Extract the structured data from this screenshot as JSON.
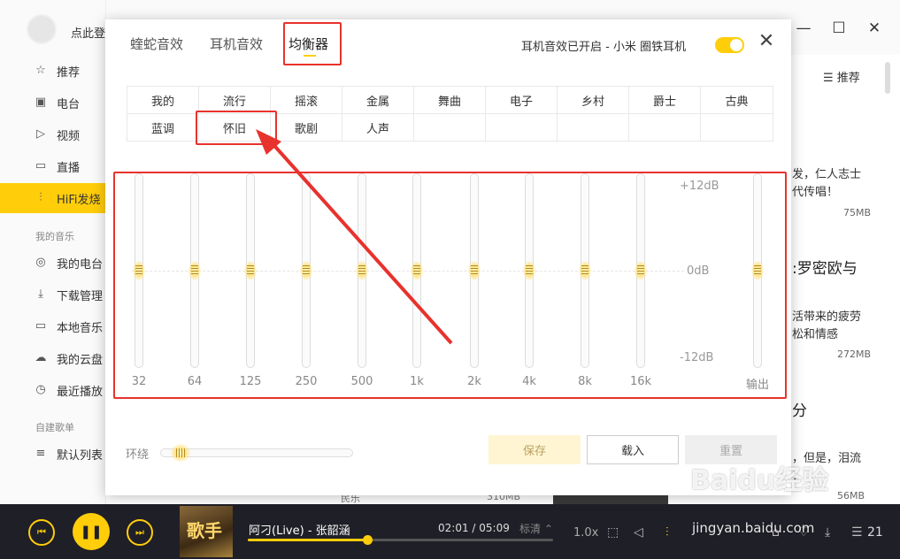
{
  "app": {
    "login_text": "点此登",
    "window_controls": [
      "—",
      "☐",
      "✕"
    ],
    "right_header": "推荐",
    "sidebar": {
      "items": [
        {
          "label": "推荐",
          "icon": "star-icon"
        },
        {
          "label": "电台",
          "icon": "radio-icon"
        },
        {
          "label": "视频",
          "icon": "video-icon"
        },
        {
          "label": "直播",
          "icon": "live-icon"
        },
        {
          "label": "HiFi发烧",
          "icon": "hifi-icon"
        }
      ],
      "section_my_music": "我的音乐",
      "my_items": [
        {
          "label": "我的电台",
          "icon": "podcast-icon"
        },
        {
          "label": "下载管理",
          "icon": "download-icon"
        },
        {
          "label": "本地音乐",
          "icon": "monitor-icon"
        },
        {
          "label": "我的云盘",
          "icon": "cloud-icon"
        },
        {
          "label": "最近播放",
          "icon": "clock-icon"
        }
      ],
      "section_playlists": "自建歌单",
      "playlist_items": [
        {
          "label": "默认列表",
          "icon": "list-icon"
        }
      ]
    },
    "background_fragments": {
      "frag1_line1": "发，仁人志士",
      "frag1_line2": "代传唱！",
      "size1": "75MB",
      "frag2_title": ":罗密欧与",
      "frag2_line1": "活带来的疲劳",
      "frag2_line2": "松和情感",
      "size2": "272MB",
      "frag3_title": "分",
      "frag3_line1": "，但是，泪流",
      "frag3_line2": "！",
      "size3": "56MB",
      "under_left": "民乐",
      "under_size": "310MB"
    }
  },
  "player": {
    "album_art_text": "歌手",
    "song_title": "阿刁(Live) - 张韶涵",
    "time": "02:01 / 05:09",
    "quality": "标清",
    "speed": "1.0x",
    "progress": 0.39,
    "count": "21"
  },
  "dialog": {
    "tabs": [
      "蝰蛇音效",
      "耳机音效",
      "均衡器"
    ],
    "active_tab_index": 2,
    "status_text": "耳机音效已开启 - 小米 圈铁耳机",
    "toggle_on": true,
    "presets": [
      [
        "我的",
        "流行",
        "摇滚",
        "金属",
        "舞曲",
        "电子",
        "乡村",
        "爵士",
        "古典"
      ],
      [
        "蓝调",
        "怀旧",
        "歌剧",
        "人声",
        "",
        "",
        "",
        "",
        ""
      ]
    ],
    "eq": {
      "bands": [
        {
          "label": "32",
          "gain_db": 0
        },
        {
          "label": "64",
          "gain_db": 0
        },
        {
          "label": "125",
          "gain_db": 0
        },
        {
          "label": "250",
          "gain_db": 0
        },
        {
          "label": "500",
          "gain_db": 0
        },
        {
          "label": "1k",
          "gain_db": 0
        },
        {
          "label": "2k",
          "gain_db": 0
        },
        {
          "label": "4k",
          "gain_db": 0
        },
        {
          "label": "8k",
          "gain_db": 0
        },
        {
          "label": "16k",
          "gain_db": 0
        }
      ],
      "output": {
        "label": "输出",
        "gain_db": 0
      },
      "db_labels": {
        "top": "+12dB",
        "mid": "0dB",
        "bottom": "-12dB"
      },
      "range_db": [
        -12,
        12
      ]
    },
    "surround_label": "环绕",
    "surround_level": 0.1,
    "buttons": {
      "save": "保存",
      "load": "载入",
      "reset": "重置"
    }
  },
  "colors": {
    "accent": "#ffcd0a",
    "annotation": "#e8322d",
    "player_bg": "#1f1f27"
  },
  "watermark": {
    "main": "Baidu经验",
    "sub": "jingyan.baidu.com"
  }
}
